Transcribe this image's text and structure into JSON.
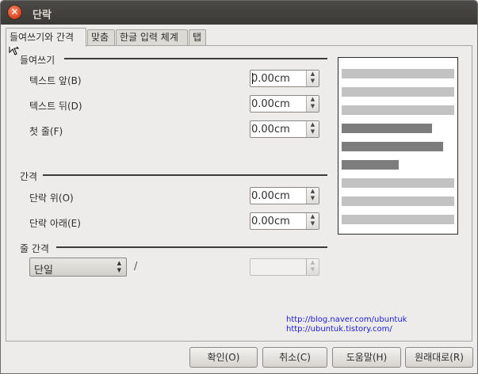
{
  "window": {
    "title": "단락"
  },
  "tabs": [
    {
      "label": "들여쓰기와 간격",
      "active": true
    },
    {
      "label": "맞춤",
      "active": false
    },
    {
      "label": "한글 입력 체계",
      "active": false
    },
    {
      "label": "탭",
      "active": false
    }
  ],
  "indent": {
    "title": "들여쓰기",
    "fields": [
      {
        "label": "텍스트 앞(B)",
        "value": "0.00cm"
      },
      {
        "label": "텍스트 뒤(D)",
        "value": "0.00cm"
      },
      {
        "label": "첫 줄(F)",
        "value": "0.00cm"
      }
    ]
  },
  "spacing": {
    "title": "간격",
    "fields": [
      {
        "label": "단락 위(O)",
        "value": "0.00cm"
      },
      {
        "label": "단락 아래(E)",
        "value": "0.00cm"
      }
    ]
  },
  "line_spacing": {
    "title": "줄 간격",
    "selected": "단일",
    "separator": "/",
    "value": ""
  },
  "links": [
    "http://blog.naver.com/ubuntuk",
    "http://ubuntuk.tistory.com/"
  ],
  "buttons": {
    "ok": "확인(O)",
    "cancel": "취소(C)",
    "help": "도움말(H)",
    "reset": "원래대로(R)"
  },
  "colors": {
    "preview_light_bar": "#c2c2c2",
    "preview_dark_bar": "#7d7d7d",
    "link": "#1a1ad0"
  }
}
